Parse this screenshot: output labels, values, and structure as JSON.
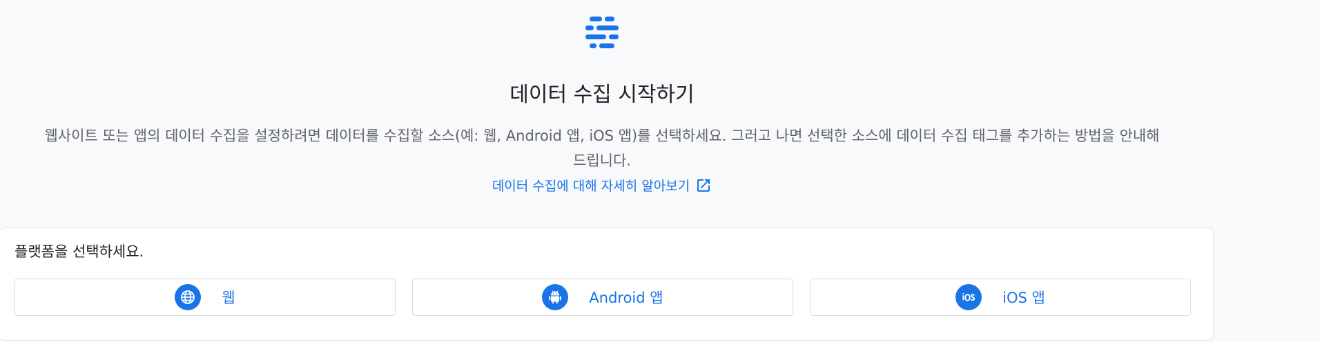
{
  "colors": {
    "accent": "#1a73e8",
    "background": "#f8f9fb",
    "card": "#ffffff",
    "border": "#dadce0"
  },
  "header": {
    "icon": "data-stream-icon",
    "title": "데이터 수집 시작하기",
    "description": "웹사이트 또는 앱의 데이터 수집을 설정하려면 데이터를 수집할 소스(예: 웹, Android 앱, iOS 앱)를 선택하세요. 그러고 나면 선택한 소스에 데이터 수집 태그를 추가하는 방법을 안내해드립니다.",
    "learn_more": "데이터 수집에 대해 자세히 알아보기",
    "learn_more_icon": "open-in-new-icon"
  },
  "platform": {
    "title": "플랫폼을 선택하세요.",
    "options": [
      {
        "label": "웹",
        "icon": "globe-icon"
      },
      {
        "label": "Android 앱",
        "icon": "android-icon"
      },
      {
        "label": "iOS 앱",
        "icon": "ios-icon"
      }
    ]
  }
}
